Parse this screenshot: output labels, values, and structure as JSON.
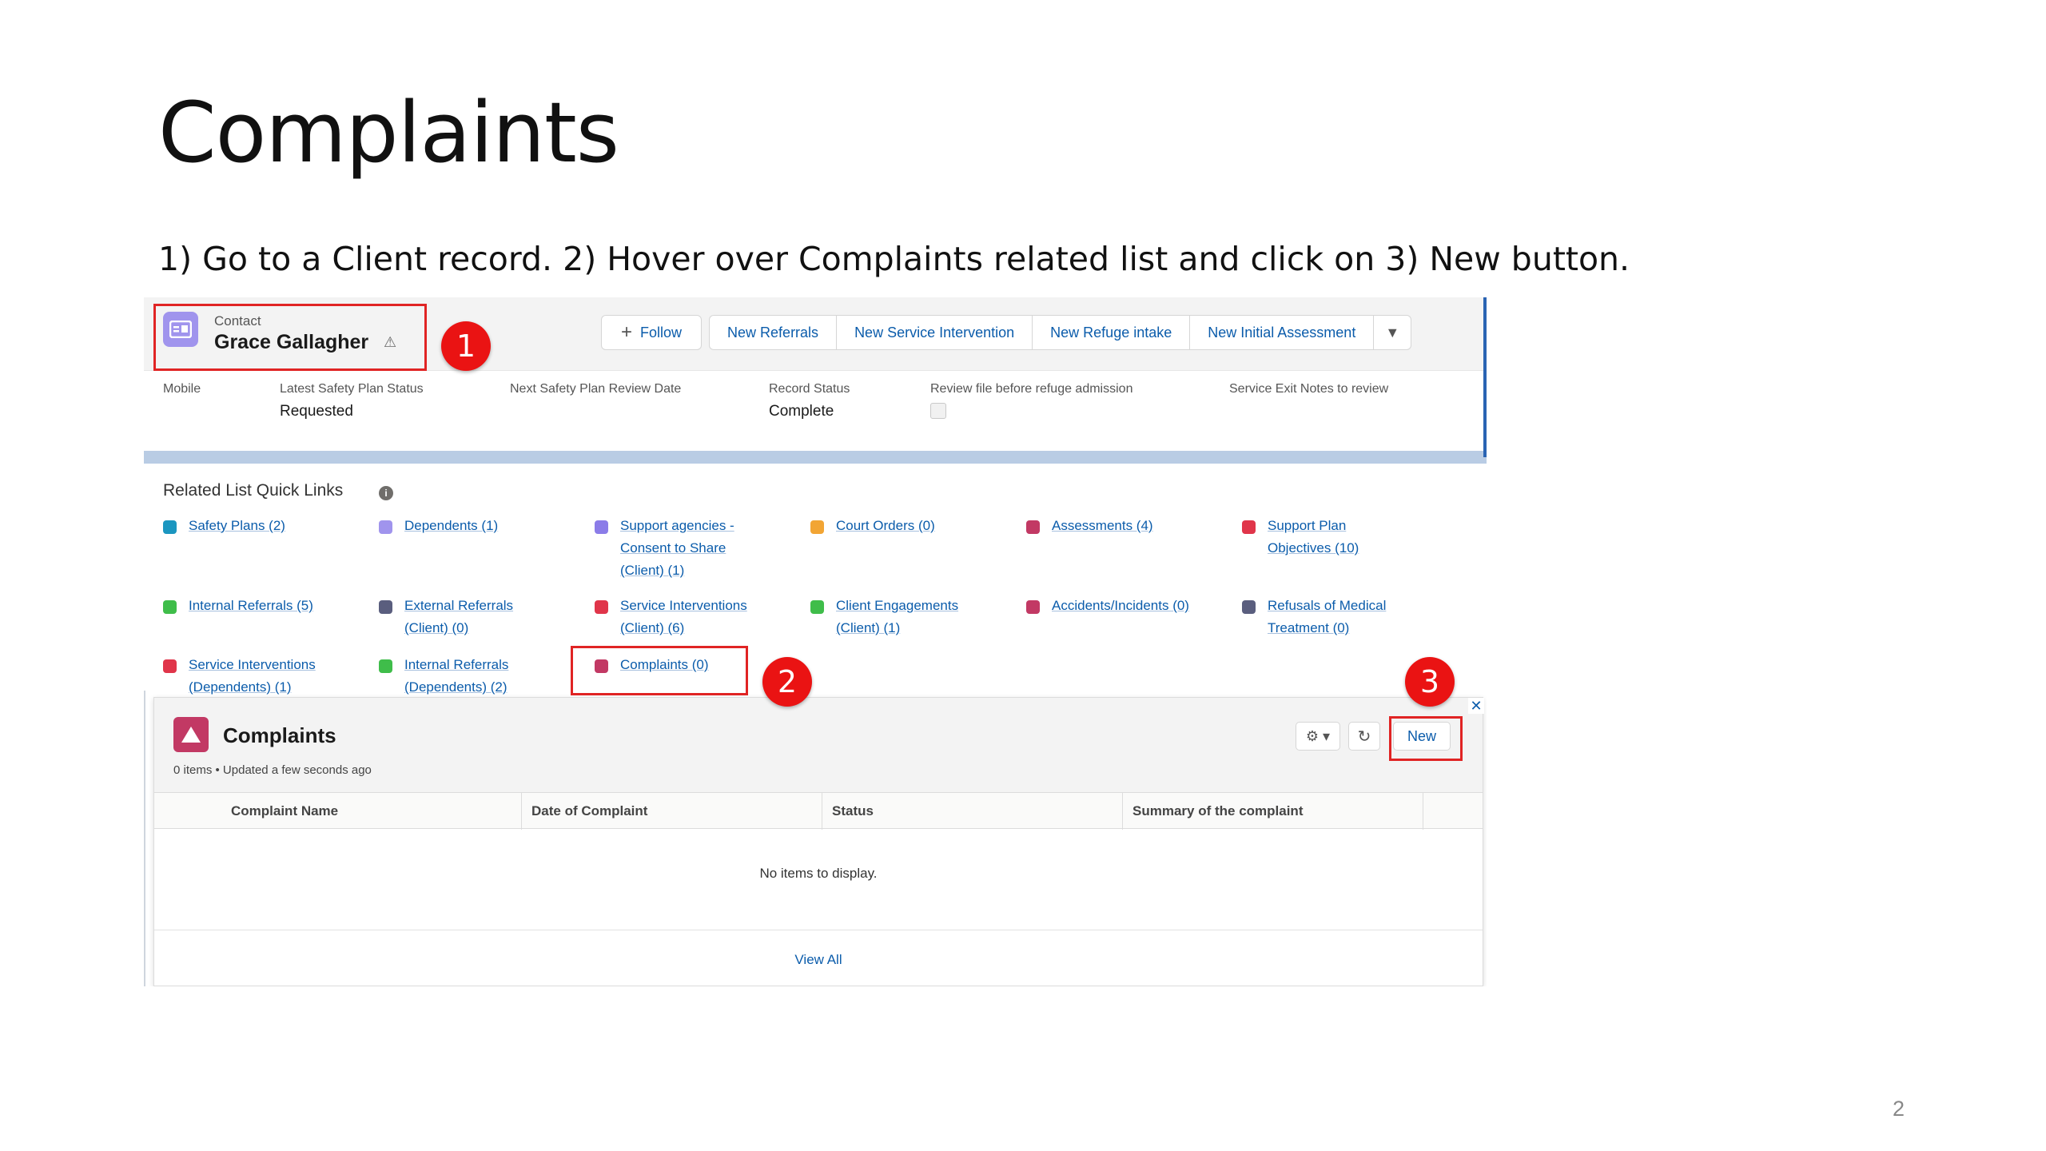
{
  "slide": {
    "title": "Complaints",
    "instruction": "1)   Go to a Client record. 2) Hover over Complaints related list and click on 3) New button.",
    "page_number": "2"
  },
  "record": {
    "object_label": "Contact",
    "name": "Grace Gallagher",
    "actions": {
      "follow": "Follow",
      "new_referrals": "New Referrals",
      "new_service_intervention": "New Service Intervention",
      "new_refuge_intake": "New Refuge intake",
      "new_initial_assessment": "New Initial Assessment"
    },
    "fields": {
      "mobile_label": "Mobile",
      "safety_status_label": "Latest Safety Plan Status",
      "safety_status_value": "Requested",
      "next_review_label": "Next Safety Plan Review Date",
      "record_status_label": "Record Status",
      "record_status_value": "Complete",
      "review_file_label": "Review file before refuge admission",
      "exit_notes_label": "Service Exit Notes to review"
    }
  },
  "quick_links": {
    "title": "Related List Quick Links",
    "items": [
      {
        "label": "Safety Plans (2)",
        "color": "#1b96c0"
      },
      {
        "label": "Dependents (1)",
        "color": "#a094ed"
      },
      {
        "label": "Support agencies - Consent to Share (Client) (1)",
        "color": "#8b7ce8"
      },
      {
        "label": "Court Orders (0)",
        "color": "#f2a534"
      },
      {
        "label": "Assessments (4)",
        "color": "#c23964"
      },
      {
        "label": "Support Plan Objectives (10)",
        "color": "#e0354a"
      },
      {
        "label": "Internal Referrals (5)",
        "color": "#3fbd4a"
      },
      {
        "label": "External Referrals (Client) (0)",
        "color": "#5a5e7e"
      },
      {
        "label": "Service Interventions (Client) (6)",
        "color": "#e0354a"
      },
      {
        "label": "Client Engagements (Client) (1)",
        "color": "#3fbd4a"
      },
      {
        "label": "Accidents/Incidents (0)",
        "color": "#c23964"
      },
      {
        "label": "Refusals of Medical Treatment (0)",
        "color": "#5a5e7e"
      },
      {
        "label": "Service Interventions (Dependents) (1)",
        "color": "#e0354a"
      },
      {
        "label": "Internal Referrals (Dependents) (2)",
        "color": "#3fbd4a"
      },
      {
        "label": "Complaints (0)",
        "color": "#c23964"
      }
    ]
  },
  "complaints_panel": {
    "title": "Complaints",
    "subtitle": "0 items • Updated a few seconds ago",
    "new_label": "New",
    "columns": [
      "Complaint Name",
      "Date of Complaint",
      "Status",
      "Summary of the complaint"
    ],
    "empty_text": "No items to display.",
    "view_all": "View All"
  },
  "callouts": [
    "1",
    "2",
    "3"
  ],
  "colors": {
    "highlight": "#e02424",
    "callout": "#ea1313",
    "link": "#0b5cab",
    "contact_icon": "#a094ed",
    "complaints_icon": "#c23964"
  }
}
